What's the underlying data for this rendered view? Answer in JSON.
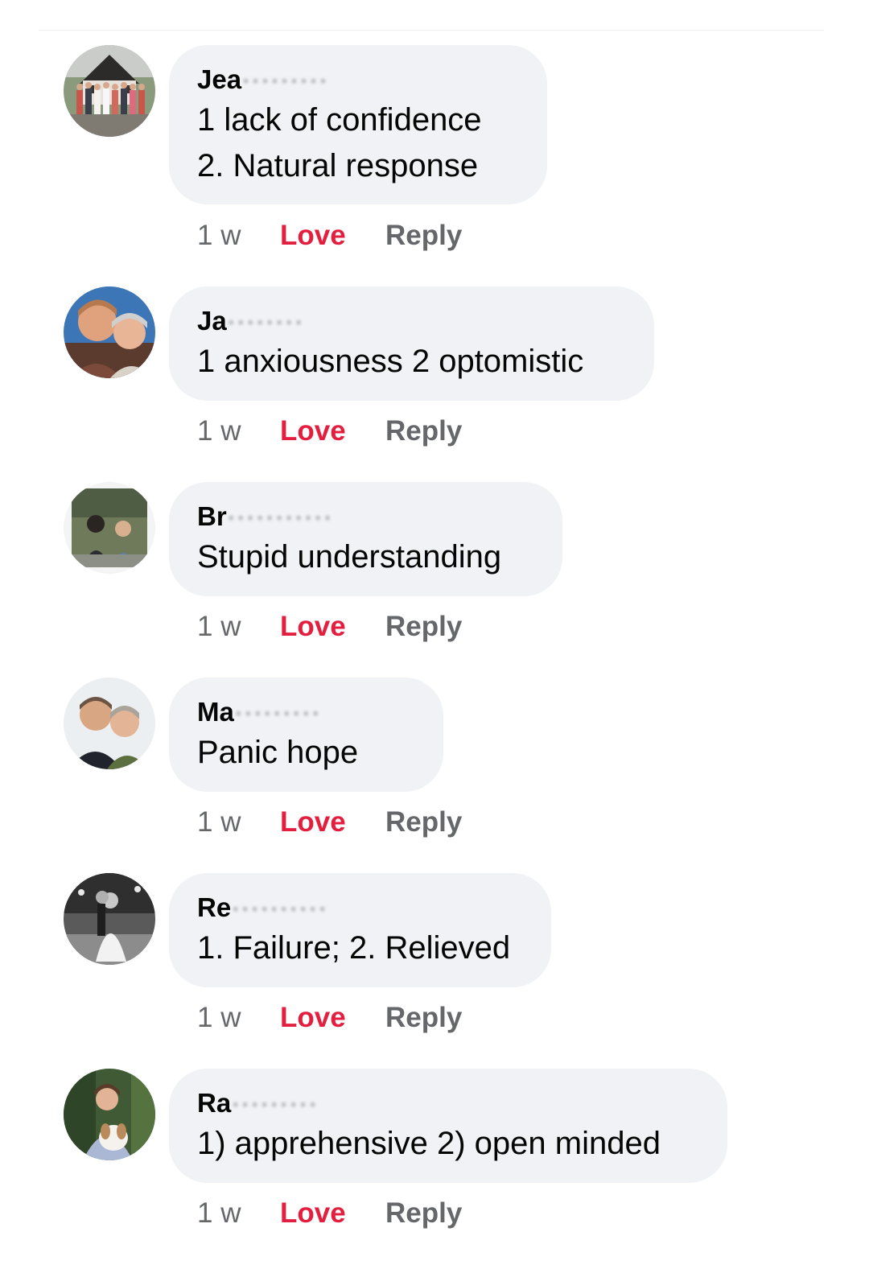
{
  "comments": [
    {
      "author_visible": "Jea",
      "author_obscured": "·········",
      "lines": [
        "1  lack of confidence",
        "2. Natural response"
      ],
      "time": "1 w",
      "love_label": "Love",
      "reply_label": "Reply",
      "avatar_icon": "profile-photo-group"
    },
    {
      "author_visible": "Ja",
      "author_obscured": "········",
      "lines": [
        "1 anxiousness  2 optomistic"
      ],
      "time": "1 w",
      "love_label": "Love",
      "reply_label": "Reply",
      "avatar_icon": "profile-photo-couple"
    },
    {
      "author_visible": "Br",
      "author_obscured": "···········",
      "lines": [
        "Stupid understanding"
      ],
      "time": "1 w",
      "love_label": "Love",
      "reply_label": "Reply",
      "avatar_icon": "profile-photo-outdoor"
    },
    {
      "author_visible": "Ma",
      "author_obscured": "·········",
      "lines": [
        "Panic hope"
      ],
      "time": "1 w",
      "love_label": "Love",
      "reply_label": "Reply",
      "avatar_icon": "profile-photo-couple"
    },
    {
      "author_visible": "Re",
      "author_obscured": "··········",
      "lines": [
        "1. Failure; 2. Relieved"
      ],
      "time": "1 w",
      "love_label": "Love",
      "reply_label": "Reply",
      "avatar_icon": "profile-photo-wedding"
    },
    {
      "author_visible": "Ra",
      "author_obscured": "·········",
      "lines": [
        "1) apprehensive 2) open minded"
      ],
      "time": "1 w",
      "love_label": "Love",
      "reply_label": "Reply",
      "avatar_icon": "profile-photo-dog"
    }
  ],
  "colors": {
    "love": "#e41e3f",
    "meta": "#65676b",
    "bubble": "#f0f2f5",
    "text": "#050505"
  }
}
